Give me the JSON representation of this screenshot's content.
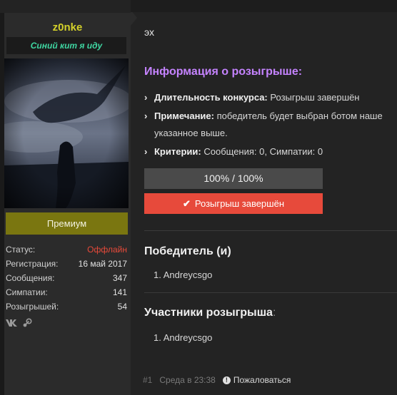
{
  "user": {
    "name": "z0nke",
    "title": "Синий кит я иду",
    "premium_label": "Премиум",
    "stats": [
      {
        "label": "Статус:",
        "value": "Оффлайн"
      },
      {
        "label": "Регистрация:",
        "value": "16 май 2017"
      },
      {
        "label": "Сообщения:",
        "value": "347"
      },
      {
        "label": "Симпатии:",
        "value": "141"
      },
      {
        "label": "Розыгрышей:",
        "value": "54"
      }
    ],
    "social_icons": [
      "vk-icon",
      "steam-icon"
    ]
  },
  "post": {
    "message": "эх",
    "giveaway_title": "Информация о розыгрыше:",
    "info": [
      {
        "key": "Длительность конкурса:",
        "value": "Розыгрыш завершён"
      },
      {
        "key": "Примечание:",
        "value": "победитель будет выбран ботом наше указанное выше."
      },
      {
        "key": "Критерии:",
        "value": "Сообщения: 0, Симпатии: 0"
      }
    ],
    "progress_text": "100% / 100%",
    "progress": 1.0,
    "ended_label": "Розыгрыш завершён",
    "winners_title": "Победитель (и)",
    "winners": [
      "1. Andreycsgo"
    ],
    "participants_title": "Участники розыгрыша",
    "participants_colon": ":",
    "participants": [
      "1. Andreycsgo"
    ]
  },
  "footer": {
    "number": "#1",
    "time": "Среда в 23:38",
    "report_label": "Пожаловаться"
  },
  "colors": {
    "accent_purple": "#c583ff",
    "username": "#d4d12a",
    "usertitle": "#3fd7a2",
    "danger": "#e74a3b",
    "premium": "#7a7610"
  }
}
